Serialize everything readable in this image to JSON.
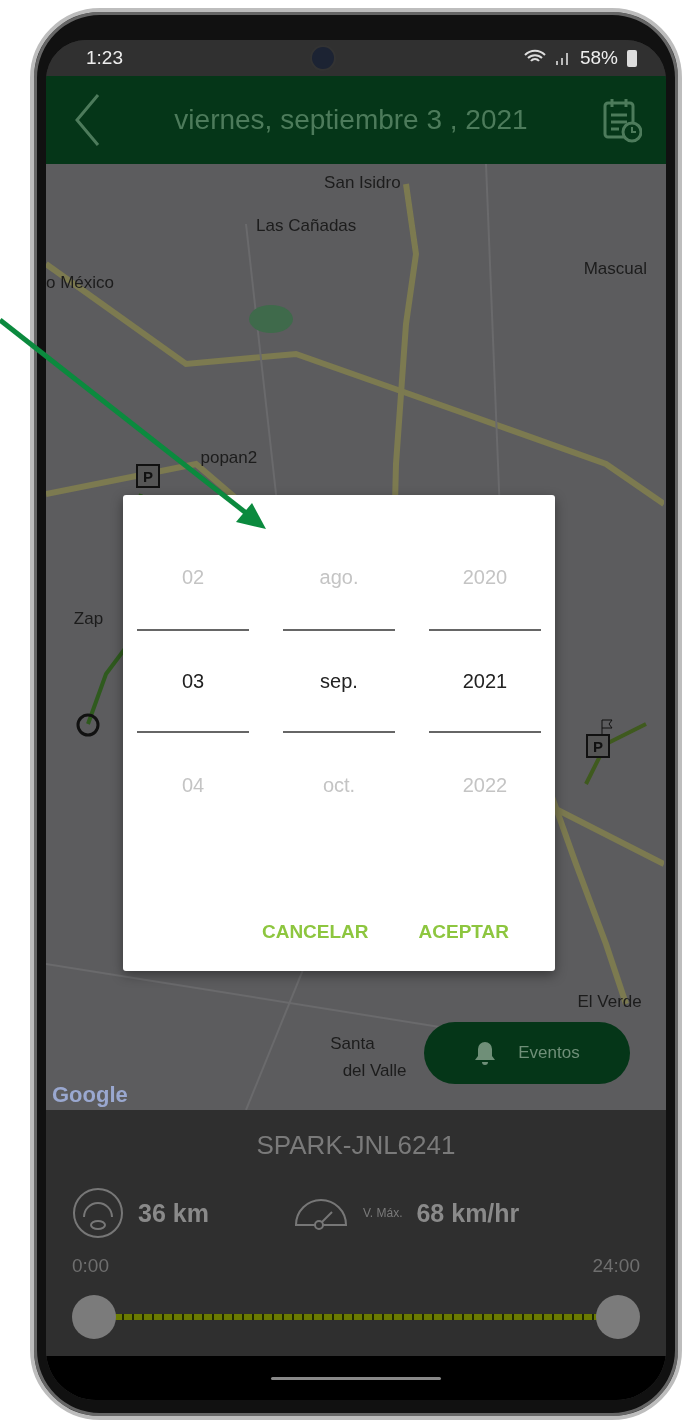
{
  "status_bar": {
    "time": "1:23",
    "battery": "58%"
  },
  "header": {
    "title": "viernes, septiembre 3 , 2021"
  },
  "map": {
    "labels": [
      {
        "text": "San Isidro"
      },
      {
        "text": "Las Cañadas"
      },
      {
        "text": "o México"
      },
      {
        "text": "Mascual"
      },
      {
        "text": "popan2"
      },
      {
        "text": "Zap"
      },
      {
        "text": "El Verde"
      },
      {
        "text": "Santa"
      },
      {
        "text": "del Valle"
      }
    ],
    "parking_markers": [
      {
        "label": "P"
      },
      {
        "label": "P"
      }
    ],
    "attribution": "Google",
    "events_button": "Eventos"
  },
  "date_picker": {
    "columns": [
      {
        "items": [
          {
            "label": "02",
            "selected": false
          },
          {
            "label": "03",
            "selected": true
          },
          {
            "label": "04",
            "selected": false
          }
        ]
      },
      {
        "items": [
          {
            "label": "ago.",
            "selected": false
          },
          {
            "label": "sep.",
            "selected": true
          },
          {
            "label": "oct.",
            "selected": false
          }
        ]
      },
      {
        "items": [
          {
            "label": "2020",
            "selected": false
          },
          {
            "label": "2021",
            "selected": true
          },
          {
            "label": "2022",
            "selected": false
          }
        ]
      }
    ],
    "buttons": [
      "CANCELAR",
      "ACEPTAR"
    ]
  },
  "vehicle": {
    "name": "SPARK-JNL6241",
    "distance": "36 km",
    "max_speed_label": "V. Máx.",
    "max_speed": "68 km/hr"
  },
  "time_range": {
    "start_label": "0:00",
    "end_label": "24:00",
    "start": {
      "level": 0
    },
    "end": {
      "level": 1
    }
  }
}
